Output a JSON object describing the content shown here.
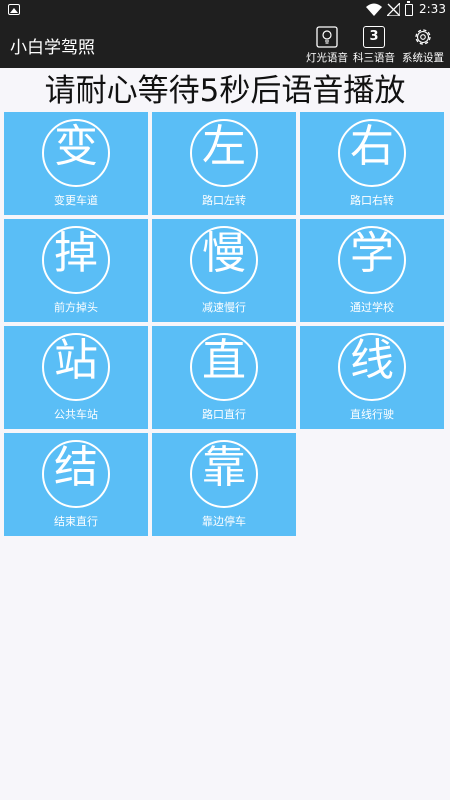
{
  "status_bar": {
    "time": "2:33",
    "icons": [
      "gallery-icon",
      "wifi-icon",
      "signal-off-icon",
      "battery-icon"
    ]
  },
  "app_bar": {
    "title": "小白学驾照",
    "actions": [
      {
        "label": "灯光语音",
        "icon": "light-bulb-icon"
      },
      {
        "label": "科三语音",
        "icon": "number-3-icon",
        "badge": "3"
      },
      {
        "label": "系统设置",
        "icon": "gear-icon"
      }
    ]
  },
  "notice": "请耐心等待5秒后语音播放",
  "tiles": [
    {
      "char": "变",
      "label": "变更车道"
    },
    {
      "char": "左",
      "label": "路口左转"
    },
    {
      "char": "右",
      "label": "路口右转"
    },
    {
      "char": "掉",
      "label": "前方掉头"
    },
    {
      "char": "慢",
      "label": "减速慢行"
    },
    {
      "char": "学",
      "label": "通过学校"
    },
    {
      "char": "站",
      "label": "公共车站"
    },
    {
      "char": "直",
      "label": "路口直行"
    },
    {
      "char": "线",
      "label": "直线行驶"
    },
    {
      "char": "结",
      "label": "结束直行"
    },
    {
      "char": "靠",
      "label": "靠边停车"
    }
  ],
  "colors": {
    "status_bar": "#1f1f1f",
    "app_bar": "#1f1f1f",
    "tile": "#5abef6",
    "background": "#f7f6fa"
  }
}
